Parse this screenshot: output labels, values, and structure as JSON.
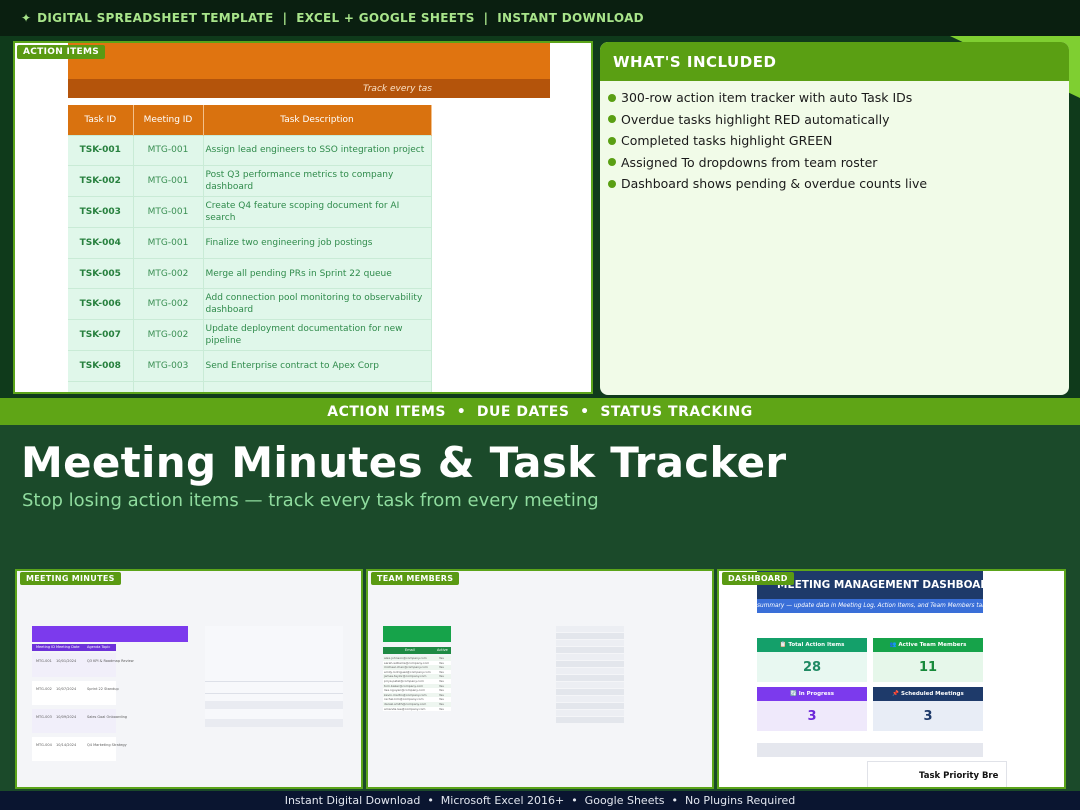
{
  "topbar": {
    "spark_glyph": "✦",
    "text": "DIGITAL SPREADSHEET TEMPLATE  |  EXCEL + GOOGLE SHEETS  |  INSTANT DOWNLOAD"
  },
  "action_items": {
    "tag": "ACTION ITEMS",
    "subheader": "Track every tas",
    "columns": [
      "Task ID",
      "Meeting ID",
      "Task Description"
    ],
    "rows": [
      {
        "task_id": "TSK-001",
        "meeting_id": "MTG-001",
        "description": "Assign lead engineers to SSO integration project"
      },
      {
        "task_id": "TSK-002",
        "meeting_id": "MTG-001",
        "description": "Post Q3 performance metrics to company dashboard"
      },
      {
        "task_id": "TSK-003",
        "meeting_id": "MTG-001",
        "description": "Create Q4 feature scoping document for AI search"
      },
      {
        "task_id": "TSK-004",
        "meeting_id": "MTG-001",
        "description": "Finalize two engineering job postings"
      },
      {
        "task_id": "TSK-005",
        "meeting_id": "MTG-002",
        "description": "Merge all pending PRs in Sprint 22 queue"
      },
      {
        "task_id": "TSK-006",
        "meeting_id": "MTG-002",
        "description": "Add connection pool monitoring to observability dashboard"
      },
      {
        "task_id": "TSK-007",
        "meeting_id": "MTG-002",
        "description": "Update deployment documentation for new pipeline"
      },
      {
        "task_id": "TSK-008",
        "meeting_id": "MTG-003",
        "description": "Send Enterprise contract to Apex Corp"
      }
    ]
  },
  "included": {
    "title": "WHAT'S INCLUDED",
    "items": [
      "300-row action item tracker with auto Task IDs",
      "Overdue tasks highlight RED automatically",
      "Completed tasks highlight GREEN",
      "Assigned To dropdowns from team roster",
      "Dashboard shows pending & overdue counts live"
    ]
  },
  "band": "ACTION ITEMS  •  DUE DATES  •  STATUS TRACKING",
  "hero": {
    "title": "Meeting Minutes & Task Tracker",
    "subtitle": "Stop losing action items — track every task from every meeting"
  },
  "meeting_minutes": {
    "tag": "MEETING MINUTES",
    "headers": [
      "Meeting ID",
      "Meeting Date",
      "Agenda Topic"
    ],
    "rows": [
      {
        "id": "MTG-001",
        "date": "10/01/2024",
        "topic": "Q3 KPI & Roadmap Review"
      },
      {
        "id": "MTG-002",
        "date": "10/07/2024",
        "topic": "Sprint 22 Standup"
      },
      {
        "id": "MTG-003",
        "date": "10/09/2024",
        "topic": "Sales Goal Onboarding"
      },
      {
        "id": "MTG-004",
        "date": "10/14/2024",
        "topic": "Q4 Marketing Strategy"
      }
    ]
  },
  "team_members": {
    "tag": "TEAM MEMBERS",
    "headers": [
      "Email",
      "Active"
    ],
    "rows": [
      {
        "email": "alex.johnson@company.com",
        "active": "Yes"
      },
      {
        "email": "sarah.williams@company.com",
        "active": "Yes"
      },
      {
        "email": "michael.chen@company.com",
        "active": "Yes"
      },
      {
        "email": "emily.rodriguez@company.com",
        "active": "Yes"
      },
      {
        "email": "james.taylor@company.com",
        "active": "Yes"
      },
      {
        "email": "priya.patel@company.com",
        "active": "Yes"
      },
      {
        "email": "tom.baker@company.com",
        "active": "Yes"
      },
      {
        "email": "lisa.nguyen@company.com",
        "active": "Yes"
      },
      {
        "email": "kevin.martin@company.com",
        "active": "Yes"
      },
      {
        "email": "rachel.kim@company.com",
        "active": "Yes"
      },
      {
        "email": "daniel.smith@company.com",
        "active": "Yes"
      },
      {
        "email": "amanda.lee@company.com",
        "active": "Yes"
      }
    ]
  },
  "dashboard": {
    "tag": "DASHBOARD",
    "title": "MEETING MANAGEMENT DASHBOARD",
    "subtitle": "summary — update data in Meeting Log, Action Items, and Team Members tabs",
    "kpis": [
      {
        "label": "📋 Total Action Items",
        "value": "28",
        "head_color": "#14a06a",
        "body_color": "#e8f8f1",
        "value_color": "#1f8a63"
      },
      {
        "label": "👥 Active Team Members",
        "value": "11",
        "head_color": "#16a34a",
        "body_color": "#e6f7ea",
        "value_color": "#188a3b"
      },
      {
        "label": "🔄 In Progress",
        "value": "3",
        "head_color": "#7c3aed",
        "body_color": "#efe9fb",
        "value_color": "#6d28d9"
      },
      {
        "label": "📌 Scheduled Meetings",
        "value": "3",
        "head_color": "#1e3a6a",
        "body_color": "#e8edf6",
        "value_color": "#1e3a6a"
      }
    ],
    "priority_label": "Task Priority Bre"
  },
  "footer": "Instant Digital Download  •  Microsoft Excel 2016+  •  Google Sheets  •  No Plugins Required"
}
